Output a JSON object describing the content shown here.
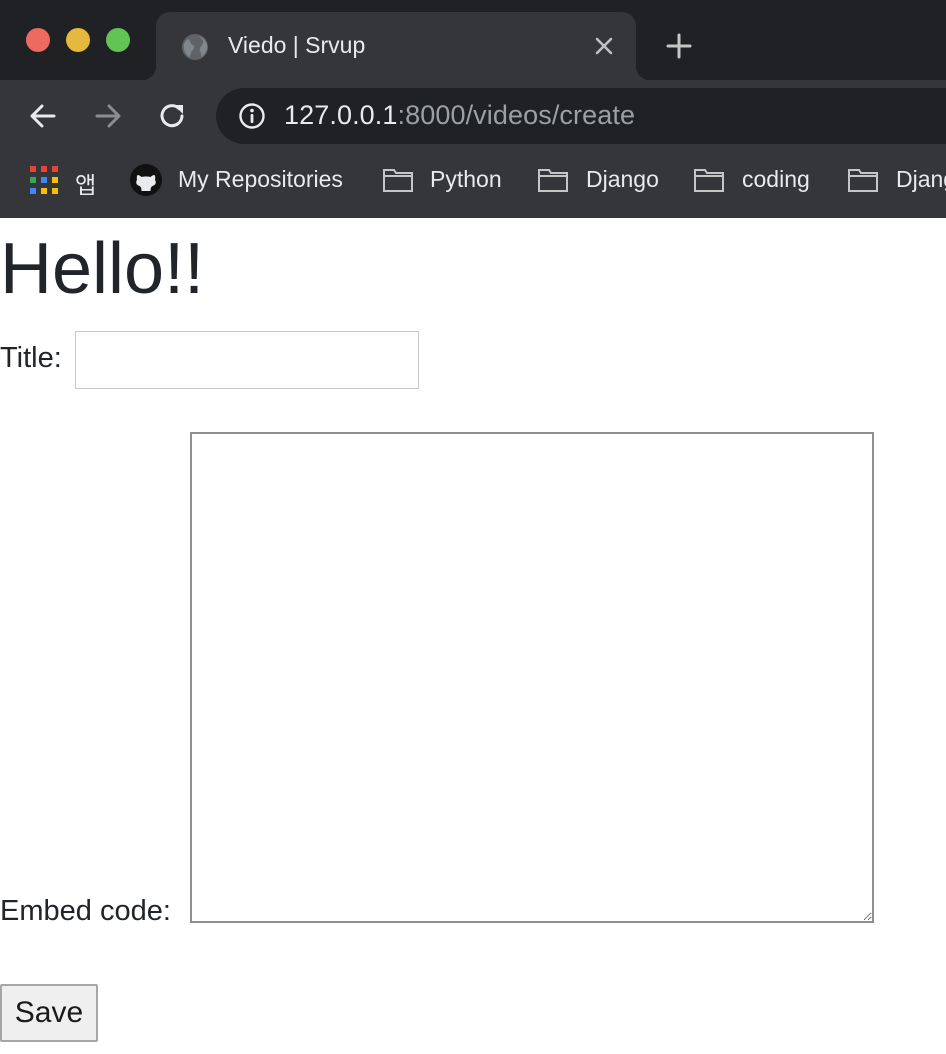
{
  "browser": {
    "tab": {
      "title": "Viedo | Srvup"
    },
    "address": {
      "host": "127.0.0.1",
      "path": ":8000/videos/create"
    },
    "bookmarks": [
      {
        "label": "앱",
        "icon": "apps-grid-icon"
      },
      {
        "label": "My Repositories",
        "icon": "github-icon"
      },
      {
        "label": "Python",
        "icon": "folder-icon"
      },
      {
        "label": "Django",
        "icon": "folder-icon"
      },
      {
        "label": "coding",
        "icon": "folder-icon"
      },
      {
        "label": "Django",
        "icon": "folder-icon"
      }
    ],
    "colors": {
      "close": "#ed6a5e",
      "minimize": "#e4b93d",
      "maximize": "#61c454"
    }
  },
  "page": {
    "heading": "Hello!!",
    "form": {
      "title_label": "Title:",
      "title_value": "",
      "embed_label": "Embed code:",
      "embed_value": "",
      "save_label": "Save"
    }
  }
}
